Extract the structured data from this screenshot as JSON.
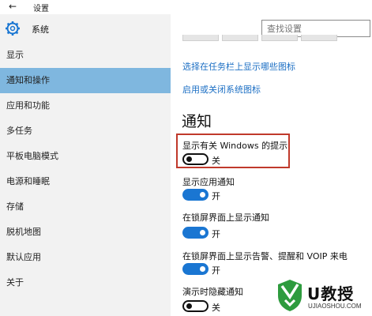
{
  "window": {
    "title": "设置",
    "back_icon": "back-arrow-icon"
  },
  "sidebar": {
    "header_label": "系统",
    "header_icon": "gear-icon",
    "items": [
      {
        "label": "显示",
        "active": false
      },
      {
        "label": "通知和操作",
        "active": true
      },
      {
        "label": "应用和功能",
        "active": false
      },
      {
        "label": "多任务",
        "active": false
      },
      {
        "label": "平板电脑模式",
        "active": false
      },
      {
        "label": "电源和睡眠",
        "active": false
      },
      {
        "label": "存储",
        "active": false
      },
      {
        "label": "脱机地图",
        "active": false
      },
      {
        "label": "默认应用",
        "active": false
      },
      {
        "label": "关于",
        "active": false
      }
    ]
  },
  "search": {
    "placeholder": "查找设置"
  },
  "main": {
    "links": [
      "选择在任务栏上显示哪些图标",
      "启用或关闭系统图标"
    ],
    "section_title": "通知",
    "options": [
      {
        "label": "显示有关 Windows 的提示",
        "state": "关",
        "on": false
      },
      {
        "label": "显示应用通知",
        "state": "开",
        "on": true
      },
      {
        "label": "在锁屏界面上显示通知",
        "state": "开",
        "on": true
      },
      {
        "label": "在锁屏界面上显示告警、提醒和 VOIP 来电",
        "state": "开",
        "on": true
      },
      {
        "label": "演示时隐藏通知",
        "state": "关",
        "on": false
      }
    ]
  },
  "watermark": {
    "brand": "U教授",
    "domain": "UJIAOSHOU.COM"
  },
  "colors": {
    "accent": "#1a76d2",
    "active_nav": "#7fb7df",
    "highlight_border": "#c0392b",
    "link": "#1c6fc4"
  }
}
